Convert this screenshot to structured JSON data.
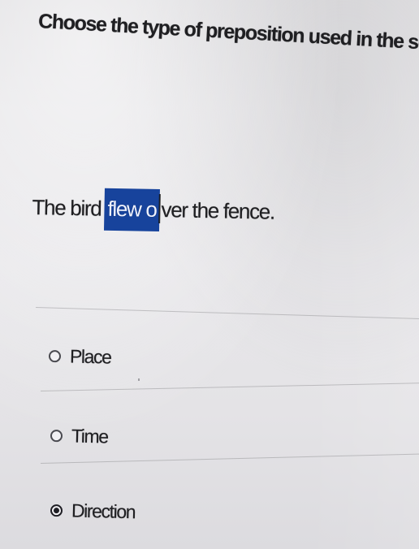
{
  "question": {
    "text": "Choose the type of preposition used in the sentence."
  },
  "sentence": {
    "before": "The bird ",
    "highlighted": "flew o",
    "after": "ver the fence."
  },
  "options": [
    {
      "label": "Place",
      "selected": false
    },
    {
      "label": "Time",
      "selected": false
    },
    {
      "label": "Direction",
      "selected": true
    }
  ]
}
